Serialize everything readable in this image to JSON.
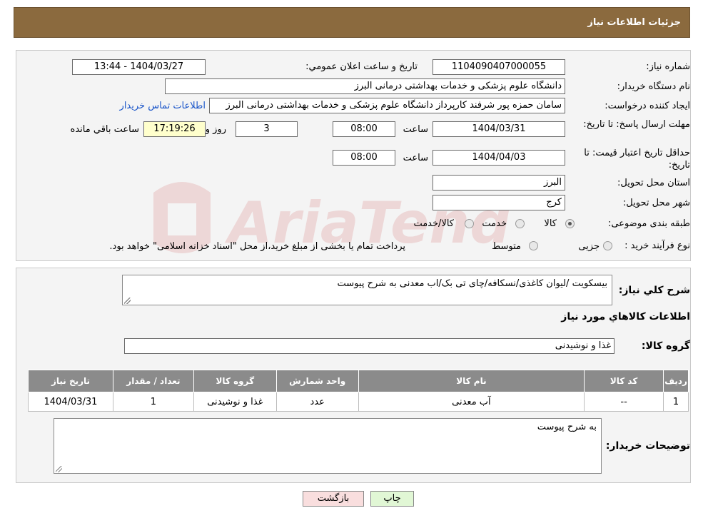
{
  "header": {
    "title": "جزئیات اطلاعات نیاز"
  },
  "form": {
    "need_number_label": "شماره نیاز:",
    "need_number": "1104090407000055",
    "announce_label": "تاریخ و ساعت اعلان عمومي:",
    "announce_value": "1404/03/27 - 13:44",
    "buyer_org_label": "نام دستگاه خریدار:",
    "buyer_org": "دانشگاه علوم پزشکی و خدمات بهداشتی  درمانی البرز",
    "creator_label": "ایجاد کننده درخواست:",
    "creator": "سامان حمزه پور شرفند کارپرداز دانشگاه علوم پزشکی و خدمات بهداشتی  درمانی البرز",
    "contact_link": "اطلاعات تماس خریدار",
    "deadline_label": "مهلت ارسال پاسخ: تا تاریخ:",
    "deadline_date": "1404/03/31",
    "time_label": "ساعت",
    "deadline_time": "08:00",
    "days": "3",
    "days_label": "روز و",
    "remaining_time": "17:19:26",
    "remaining_label": "ساعت باقي مانده",
    "validity_label": "حداقل تاریخ اعتبار قیمت: تا تاریخ:",
    "validity_date": "1404/04/03",
    "validity_time": "08:00",
    "province_label": "استان محل تحویل:",
    "province": "البرز",
    "city_label": "شهر محل تحویل:",
    "city": "کرج",
    "category_label": "طبقه بندی موضوعی:",
    "category_options": [
      "کالا",
      "خدمت",
      "کالا/خدمت"
    ],
    "process_label": "نوع فرآیند خرید :",
    "process_options": [
      "جزیی",
      "متوسط"
    ],
    "process_note": "پرداخت تمام یا بخشی از مبلغ خرید،از محل \"اسناد خزانه اسلامی\" خواهد بود."
  },
  "description": {
    "summary_label": "شرح کلي نیاز:",
    "summary": "بیسکویت /لیوان کاغذی/نسکافه/چای تی بک/اب معدنی به شرح پیوست",
    "items_title": "اطلاعات کالاهاي مورد نیاز",
    "group_label": "گروه کالا:",
    "group": "غذا و نوشیدنی"
  },
  "table": {
    "headers": [
      "ردیف",
      "کد کالا",
      "نام کالا",
      "واحد شمارش",
      "گروه کالا",
      "تعداد / مقدار",
      "تاریخ نیاز"
    ],
    "rows": [
      [
        "1",
        "--",
        "آب معدنی",
        "عدد",
        "غذا و نوشیدنی",
        "1",
        "1404/03/31"
      ]
    ]
  },
  "buyer_notes": {
    "label": "توضیحات خریدار:",
    "text": "به شرح پیوست"
  },
  "buttons": {
    "print": "چاپ",
    "back": "بازگشت"
  },
  "watermark": {
    "text": "AriaTender.neT"
  },
  "colors": {
    "header_bg": "#8b6a3e",
    "table_header_bg": "#8b8b8b",
    "link": "#1a55c9",
    "back_button_bg": "#f9dede",
    "print_button_bg": "#e1f7d5"
  }
}
